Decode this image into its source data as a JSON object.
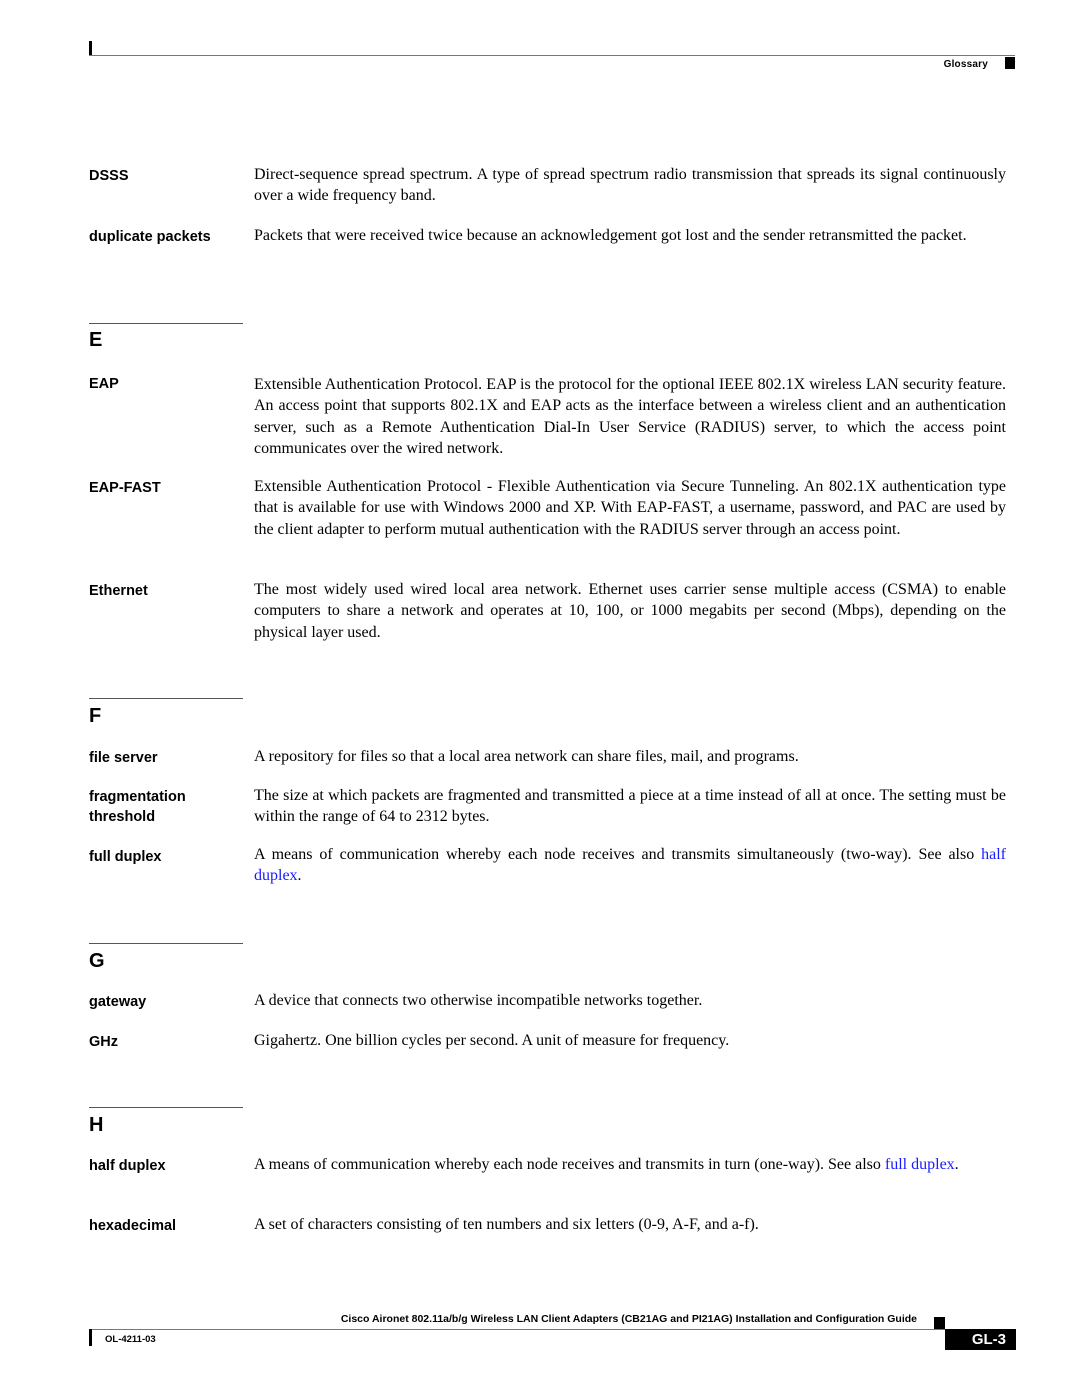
{
  "header": {
    "section_label": "Glossary"
  },
  "sections": [
    {
      "letter": "",
      "entries": [
        {
          "term": "DSSS",
          "definition": "Direct-sequence spread spectrum. A type of spread spectrum radio transmission that spreads its signal continuously over a wide frequency band."
        },
        {
          "term": "duplicate packets",
          "definition": "Packets that were received twice because an acknowledgement got lost and the sender retransmitted the packet."
        }
      ]
    },
    {
      "letter": "E",
      "entries": [
        {
          "term": "EAP",
          "definition": "Extensible Authentication Protocol. EAP is the protocol for the optional IEEE 802.1X wireless LAN security feature. An access point that supports 802.1X and EAP acts as the interface between a wireless client and an authentication server, such as a Remote Authentication Dial-In User Service (RADIUS) server, to which the access point communicates over the wired network."
        },
        {
          "term": "EAP-FAST",
          "definition": "Extensible Authentication Protocol - Flexible Authentication via Secure Tunneling. An 802.1X authentication type that is available for use with Windows 2000 and XP. With EAP-FAST, a username, password, and PAC are used by the client adapter to perform mutual authentication with the RADIUS server through an access point."
        },
        {
          "term": "Ethernet",
          "definition": "The most widely used wired local area network. Ethernet uses carrier sense multiple access (CSMA) to enable computers to share a network and operates at 10, 100, or 1000 megabits per second (Mbps), depending on the physical layer used."
        }
      ]
    },
    {
      "letter": "F",
      "entries": [
        {
          "term": "file server",
          "definition": "A repository for files so that a local area network can share files, mail, and programs."
        },
        {
          "term_line1": "fragmentation",
          "term_line2": "threshold",
          "definition": "The size at which packets are fragmented and transmitted a piece at a time instead of all at once. The setting must be within the range of 64 to 2312 bytes."
        },
        {
          "term": "full duplex",
          "definition": "A means of communication whereby each node receives and transmits simultaneously (two-way). See also ",
          "link": "half duplex",
          "suffix": "."
        }
      ]
    },
    {
      "letter": "G",
      "entries": [
        {
          "term": "gateway",
          "definition": "A device that connects two otherwise incompatible networks together."
        },
        {
          "term": "GHz",
          "definition": "Gigahertz. One billion cycles per second. A unit of measure for frequency."
        }
      ]
    },
    {
      "letter": "H",
      "entries": [
        {
          "term": "half duplex",
          "definition": "A means of communication whereby each node receives and transmits in turn (one-way). See also ",
          "link": "full duplex",
          "suffix": "."
        },
        {
          "term": "hexadecimal",
          "definition": "A set of characters consisting of ten numbers and six letters (0-9, A-F, and a-f)."
        }
      ]
    }
  ],
  "footer": {
    "guide_title": "Cisco Aironet 802.11a/b/g Wireless LAN Client Adapters (CB21AG and PI21AG) Installation and Configuration Guide",
    "doc_number": "OL-4211-03",
    "page_number": "GL-3"
  }
}
